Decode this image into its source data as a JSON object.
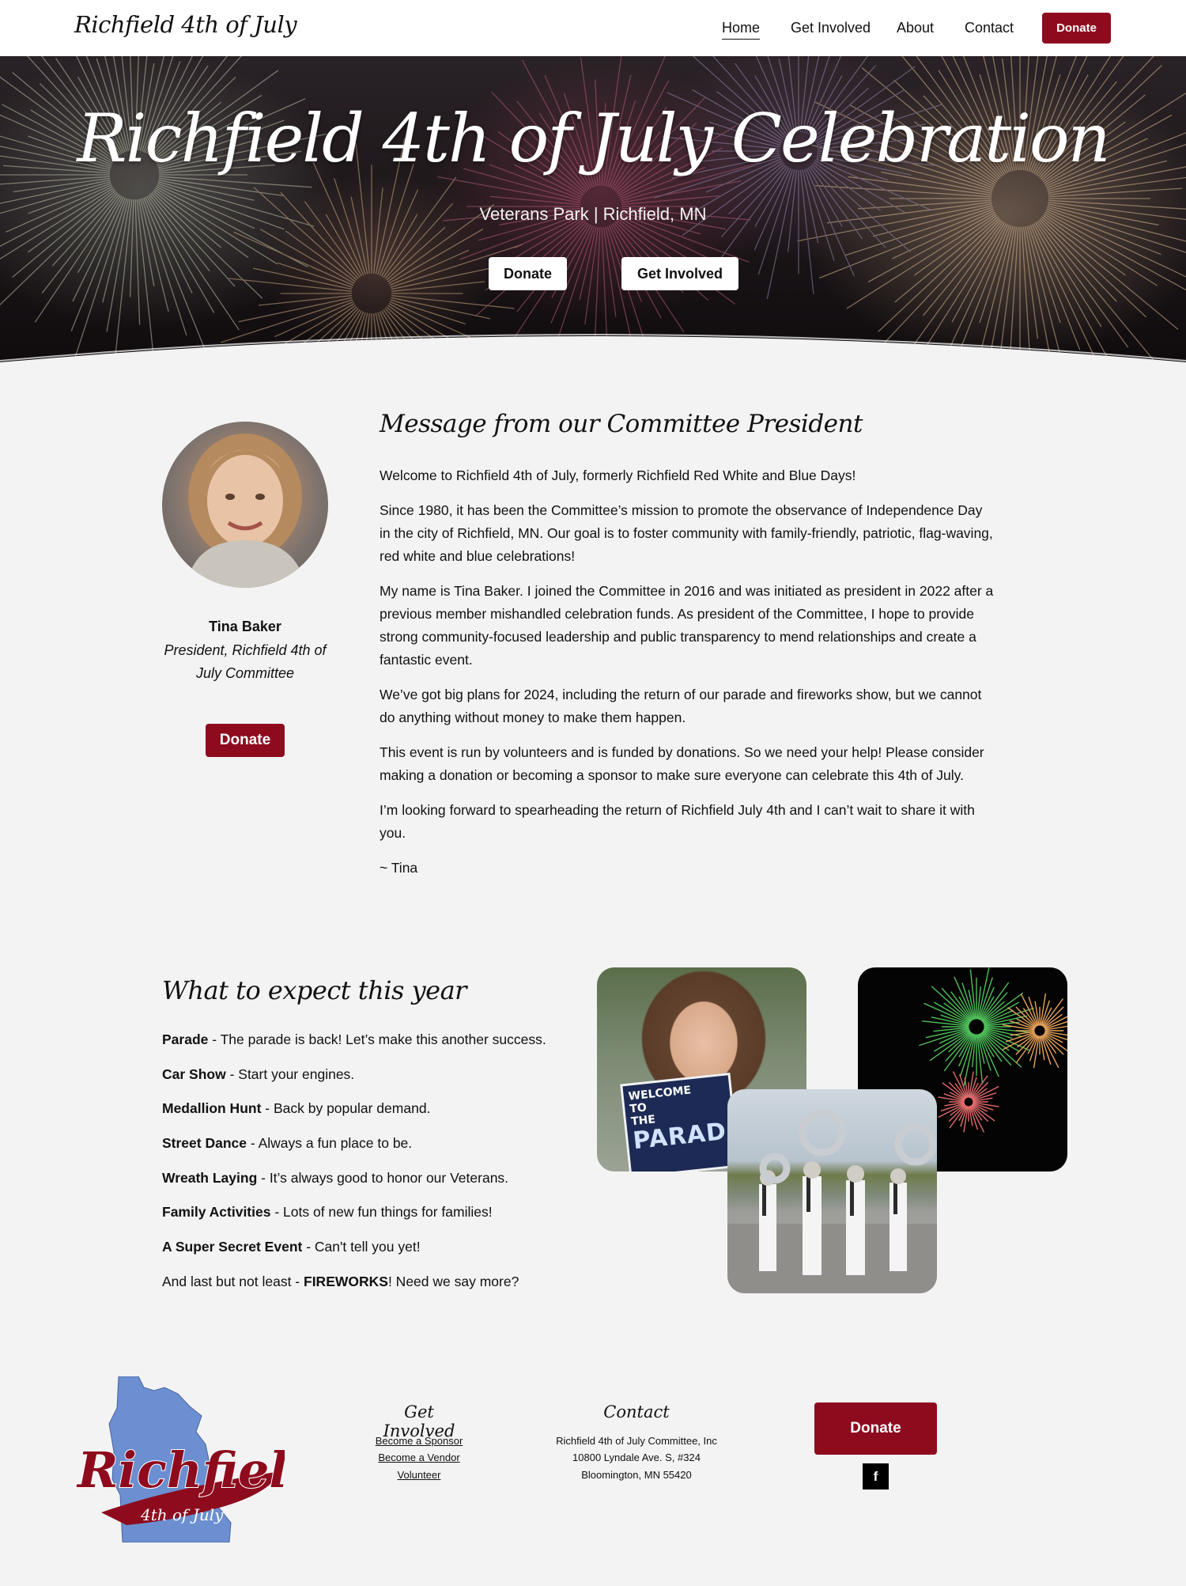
{
  "nav": {
    "brand": "Richfield 4th of July",
    "links": [
      "Home",
      "Get Involved",
      "About",
      "Contact"
    ],
    "donate_label": "Donate"
  },
  "hero": {
    "title": "Richfield 4th of July Celebration",
    "subtitle": "Veterans Park | Richfield, MN",
    "donate_label": "Donate",
    "get_involved_label": "Get Involved"
  },
  "president": {
    "name": "Tina Baker",
    "title": "President, Richfield 4th of July Committee",
    "donate_label": "Donate",
    "heading": "Message from our Committee President",
    "paragraphs": [
      "Welcome to Richfield 4th of July, formerly Richfield Red White and Blue Days!",
      "Since 1980, it has been the Committee’s mission to promote the observance of Independence Day in the city of Richfield, MN.  Our goal is to foster community with family-friendly, patriotic, flag-waving, red white and blue celebrations!",
      "My name is Tina Baker. I joined the Committee in 2016 and was initiated as president in 2022 after a previous member mishandled celebration funds. As president of the Committee, I hope to provide strong community-focused leadership and public transparency to mend relationships and create a fantastic event.",
      "We’ve got big plans for 2024, including the return of our parade and fireworks show, but we cannot do anything without money to make them happen.",
      "This event is run by volunteers and is funded by donations. So we need your help! Please consider making a donation or becoming a sponsor to make sure everyone can celebrate this 4th of July.",
      "I’m looking forward to spearheading the return of Richfield July 4th and I can’t wait to share it with you.",
      "~ Tina"
    ]
  },
  "expect": {
    "heading": "What to expect this year",
    "items": [
      {
        "bold": "Parade",
        "text": " - The parade is back!  Let’s make this another success."
      },
      {
        "bold": "Car Show",
        "text": " - Start your engines."
      },
      {
        "bold": "Medallion Hunt",
        "text": " - Back by popular demand."
      },
      {
        "bold": "Street Dance",
        "text": " - Always a fun place to be."
      },
      {
        "bold": "Wreath Laying",
        "text": "  - It’s always good to honor our Veterans."
      },
      {
        "bold": "Family Activities",
        "text": " -  Lots of new fun things for families!"
      },
      {
        "bold": "A Super Secret Event",
        "text": " - Can't tell you yet!"
      }
    ],
    "last_pre": "And last but not least - ",
    "last_bold": "FIREWORKS",
    "last_post": "!  Need we say more?",
    "sign": {
      "line1": "WELCOME",
      "line2": "TO",
      "line3": "THE",
      "line4": "PARADE"
    }
  },
  "footer": {
    "logo": {
      "word": "Richfield",
      "sub": "4th of July"
    },
    "get_involved_heading": "Get Involved",
    "get_involved_links": [
      "Become a Sponsor",
      "Become a Vendor",
      "Volunteer"
    ],
    "contact_heading": "Contact",
    "contact_lines": [
      "Richfield 4th of July Committee, Inc",
      "10800 Lyndale Ave. S, #324",
      "Bloomington, MN 55420"
    ],
    "donate_label": "Donate",
    "facebook_icon": "facebook-icon",
    "facebook_glyph": "f"
  },
  "colors": {
    "accent": "#8e0b1e",
    "background": "#f3f3f3",
    "logo_blue": "#6b8fd0"
  }
}
